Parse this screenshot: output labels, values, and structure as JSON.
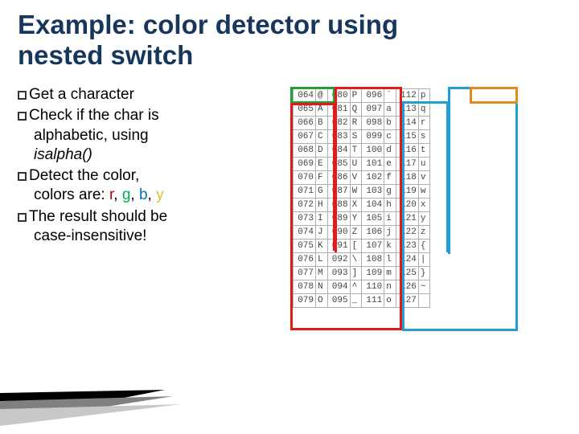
{
  "title_line1": "Example: color detector using",
  "title_line2": "nested switch",
  "bullets": {
    "b0a": "Get",
    "b0b": " a character",
    "b1a": "Check",
    "b1b": " if the char is",
    "b1c": "alphabetic, using",
    "b1d": "isalpha()",
    "b2a": "Detect",
    "b2b": " the color,",
    "b2c": "colors are: ",
    "r": "r",
    "g": "g",
    "bl": "b",
    "y": "y",
    "sep": ", ",
    "b3a": "The",
    "b3b": " result should be",
    "b3c": "case-insensitive!"
  },
  "ascii": {
    "cols": [
      [
        [
          "064",
          "@"
        ],
        [
          "065",
          "A"
        ],
        [
          "066",
          "B"
        ],
        [
          "067",
          "C"
        ],
        [
          "068",
          "D"
        ],
        [
          "069",
          "E"
        ],
        [
          "070",
          "F"
        ],
        [
          "071",
          "G"
        ],
        [
          "072",
          "H"
        ],
        [
          "073",
          "I"
        ],
        [
          "074",
          "J"
        ],
        [
          "075",
          "K"
        ],
        [
          "076",
          "L"
        ],
        [
          "077",
          "M"
        ],
        [
          "078",
          "N"
        ],
        [
          "079",
          "O"
        ]
      ],
      [
        [
          "080",
          "P"
        ],
        [
          "081",
          "Q"
        ],
        [
          "082",
          "R"
        ],
        [
          "083",
          "S"
        ],
        [
          "084",
          "T"
        ],
        [
          "085",
          "U"
        ],
        [
          "086",
          "V"
        ],
        [
          "087",
          "W"
        ],
        [
          "088",
          "X"
        ],
        [
          "089",
          "Y"
        ],
        [
          "090",
          "Z"
        ],
        [
          "091",
          "["
        ],
        [
          "092",
          "\\"
        ],
        [
          "093",
          "]"
        ],
        [
          "094",
          "^"
        ],
        [
          "095",
          "_"
        ]
      ],
      [
        [
          "096",
          "`"
        ],
        [
          "097",
          "a"
        ],
        [
          "098",
          "b"
        ],
        [
          "099",
          "c"
        ],
        [
          "100",
          "d"
        ],
        [
          "101",
          "e"
        ],
        [
          "102",
          "f"
        ],
        [
          "103",
          "g"
        ],
        [
          "104",
          "h"
        ],
        [
          "105",
          "i"
        ],
        [
          "106",
          "j"
        ],
        [
          "107",
          "k"
        ],
        [
          "108",
          "l"
        ],
        [
          "109",
          "m"
        ],
        [
          "110",
          "n"
        ],
        [
          "111",
          "o"
        ]
      ],
      [
        [
          "112",
          "p"
        ],
        [
          "113",
          "q"
        ],
        [
          "114",
          "r"
        ],
        [
          "115",
          "s"
        ],
        [
          "116",
          "t"
        ],
        [
          "117",
          "u"
        ],
        [
          "118",
          "v"
        ],
        [
          "119",
          "w"
        ],
        [
          "120",
          "x"
        ],
        [
          "121",
          "y"
        ],
        [
          "122",
          "z"
        ],
        [
          "123",
          "{"
        ],
        [
          "124",
          "|"
        ],
        [
          "125",
          "}"
        ],
        [
          "126",
          "~"
        ],
        [
          "127",
          " "
        ]
      ]
    ]
  }
}
